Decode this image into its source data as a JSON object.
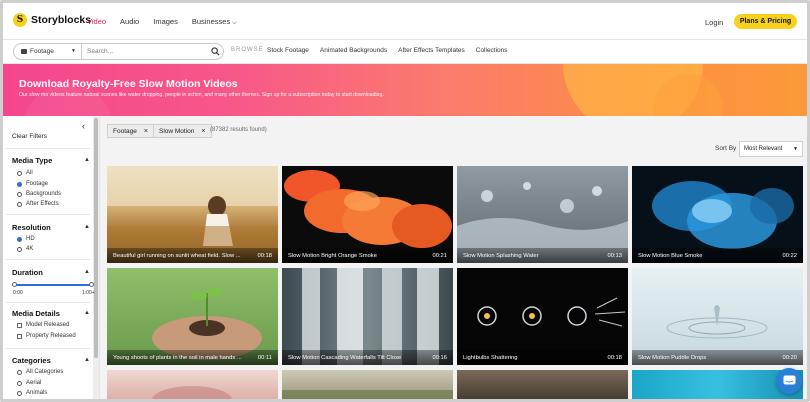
{
  "nav": {
    "logo_mark": "S",
    "logo_text": "Storyblocks",
    "links": [
      "Video",
      "Audio",
      "Images",
      "Businesses"
    ],
    "login": "Login",
    "pricing": "Plans & Pricing"
  },
  "search": {
    "type": "Footage",
    "placeholder": "Search...",
    "browse_label": "BROWSE",
    "categories": [
      "Stock Footage",
      "Animated Backgrounds",
      "After Effects Templates",
      "Collections"
    ]
  },
  "banner": {
    "title": "Download Royalty-Free Slow Motion Videos",
    "subtitle": "Our slow mo videos feature natural scenes like water dropping, people in action, and many other themes. Sign up for a subscription today to start downloading."
  },
  "sidebar": {
    "clear": "Clear Filters",
    "media_type": {
      "title": "Media Type",
      "options": [
        "All",
        "Footage",
        "Backgrounds",
        "After Effects"
      ]
    },
    "resolution": {
      "title": "Resolution",
      "options": [
        "HD",
        "4K"
      ]
    },
    "duration": {
      "title": "Duration",
      "min": "0:00",
      "max": "1:00+"
    },
    "media_details": {
      "title": "Media Details",
      "options": [
        "Model Released",
        "Property Released"
      ]
    },
    "categories": {
      "title": "Categories",
      "options": [
        "All Categories",
        "Aerial",
        "Animals"
      ]
    }
  },
  "results": {
    "chips": [
      "Footage",
      "Slow Motion"
    ],
    "count": "(87382 results found)",
    "sort_label": "Sort By",
    "sort_value": "Most Relevant"
  },
  "videos": [
    {
      "title": "Beautiful girl running on sunlit wheat field. Slow ...",
      "duration": "00:18"
    },
    {
      "title": "Slow Motion Bright Orange Smoke",
      "duration": "00:21"
    },
    {
      "title": "Slow Motion Splashing Water",
      "duration": "00:13"
    },
    {
      "title": "Slow Motion Blue Smoke",
      "duration": "00:22"
    },
    {
      "title": "Young shoots of plants in the soil in male hands ...",
      "duration": "00:11"
    },
    {
      "title": "Slow Motion Cascading Waterfalls Tilt Close",
      "duration": "00:16"
    },
    {
      "title": "Lightbulbs Shattering",
      "duration": "00:18"
    },
    {
      "title": "Slow Motion Puddle Drops",
      "duration": "00:20"
    }
  ],
  "colors": {
    "accent": "#e0245e",
    "cta": "#f7d21d",
    "link_blue": "#2b6fd6",
    "chat": "#2780d6"
  }
}
